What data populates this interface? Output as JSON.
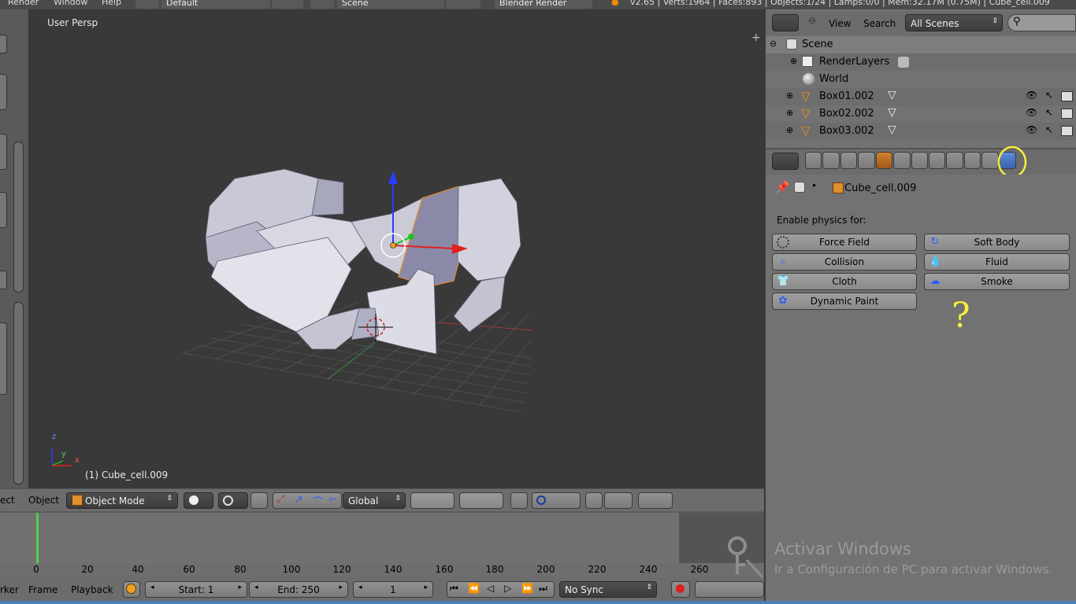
{
  "topbar": {
    "menus": [
      "Render",
      "Window",
      "Help"
    ],
    "screen_layout": "Default",
    "scene": "Scene",
    "engine": "Blender Render",
    "stats": "v2.65 | Verts:1964 | Faces:893 | Objects:1/24 | Lamps:0/0 | Mem:32.17M (0.75M) | Cube_cell.009"
  },
  "viewport": {
    "view_label": "User Persp",
    "active_object_label": "(1) Cube_cell.009",
    "axis_letters": [
      "z",
      "y",
      "x"
    ]
  },
  "view3d_header": {
    "menus": [
      "ect",
      "Object"
    ],
    "mode": "Object Mode",
    "orientation": "Global"
  },
  "timeline": {
    "ticks": [
      "0",
      "20",
      "40",
      "60",
      "80",
      "100",
      "120",
      "140",
      "160",
      "180",
      "200",
      "220",
      "240",
      "260"
    ],
    "current_frame_marker": 1,
    "menus": [
      "rker",
      "Frame",
      "Playback"
    ],
    "start": "Start: 1",
    "end": "End: 250",
    "current": "1",
    "sync": "No Sync"
  },
  "outliner": {
    "header": {
      "view": "View",
      "search": "Search",
      "filter": "All Scenes"
    },
    "items": [
      {
        "label": "Scene",
        "icon": "scene-icon"
      },
      {
        "label": "RenderLayers",
        "icon": "renderlayers-icon"
      },
      {
        "label": "World",
        "icon": "world-icon"
      },
      {
        "label": "Box01.002",
        "icon": "mesh-object-icon"
      },
      {
        "label": "Box02.002",
        "icon": "mesh-object-icon"
      },
      {
        "label": "Box03.002",
        "icon": "mesh-object-icon"
      }
    ]
  },
  "properties": {
    "breadcrumb_object": "Cube_cell.009",
    "section_label": "Enable physics for:",
    "physics_buttons": [
      {
        "label": "Force Field",
        "icon": "force-field-icon"
      },
      {
        "label": "Soft Body",
        "icon": "soft-body-icon"
      },
      {
        "label": "Collision",
        "icon": "collision-icon"
      },
      {
        "label": "Fluid",
        "icon": "fluid-icon"
      },
      {
        "label": "Cloth",
        "icon": "cloth-icon"
      },
      {
        "label": "Smoke",
        "icon": "smoke-icon"
      },
      {
        "label": "Dynamic Paint",
        "icon": "dynamic-paint-icon"
      }
    ],
    "annotation_mark": "?",
    "highlight_color": "#f5f03a"
  },
  "watermark": {
    "title": "Activar Windows",
    "subtitle": "Ir a Configuración de PC para activar Windows."
  }
}
